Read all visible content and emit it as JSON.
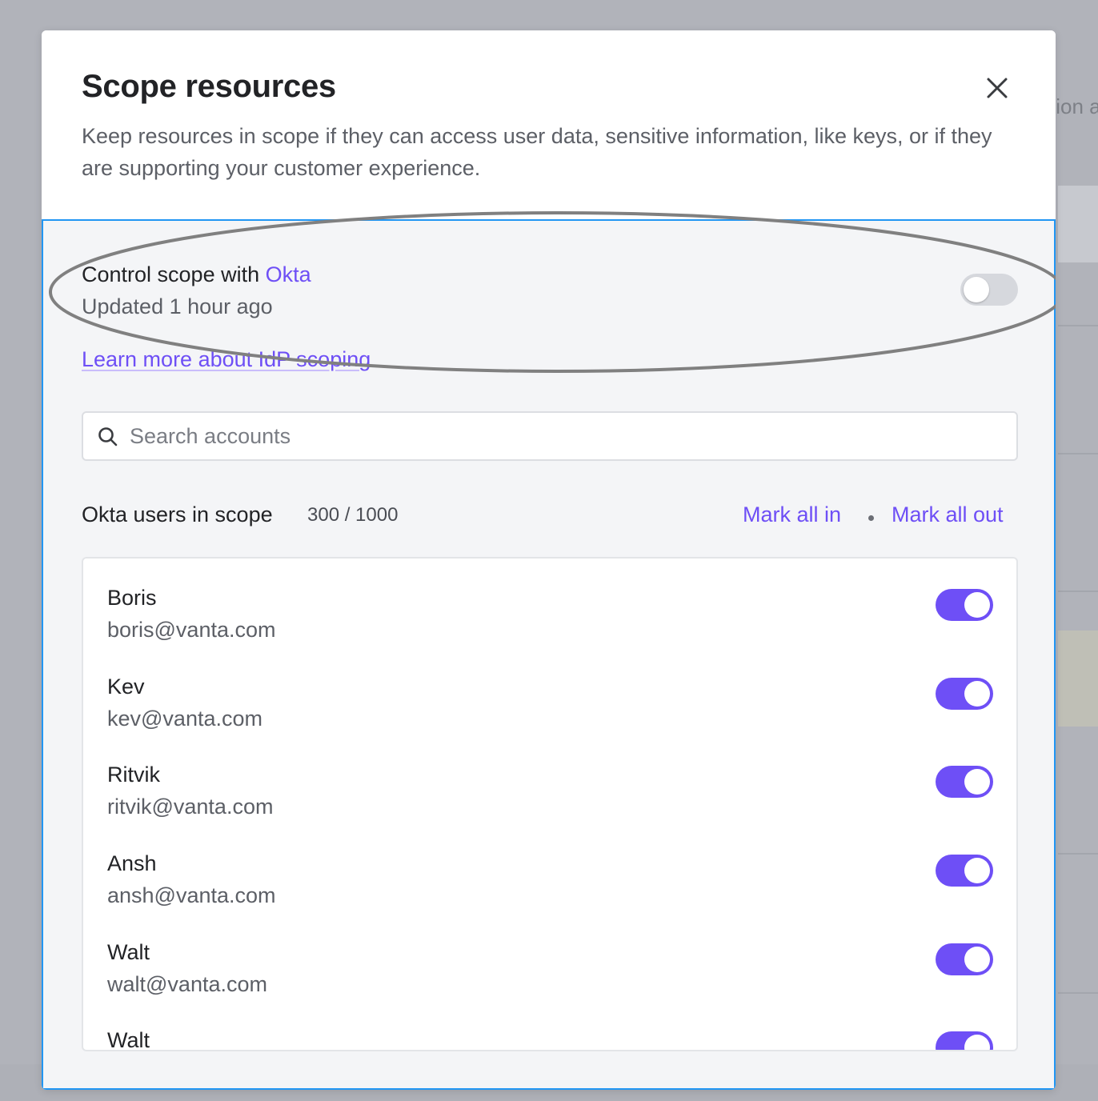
{
  "background": {
    "partial_text": "tion a"
  },
  "modal": {
    "title": "Scope resources",
    "close_icon": "close-icon",
    "subtitle": "Keep resources in scope if they can access user data, sensitive information, like keys, or if they are supporting your customer experience.",
    "idp": {
      "title_prefix": "Control scope with ",
      "provider": "Okta",
      "updated": "Updated 1 hour ago",
      "toggle_on": false,
      "learn_more": "Learn more about IdP scoping"
    },
    "search": {
      "placeholder": "Search accounts",
      "value": ""
    },
    "list": {
      "heading": "Okta users in scope",
      "count": "300 / 1000",
      "mark_all_in": "Mark all in",
      "mark_all_out": "Mark all out",
      "users": [
        {
          "name": "Boris",
          "email": "boris@vanta.com",
          "in_scope": true
        },
        {
          "name": "Kev",
          "email": "kev@vanta.com",
          "in_scope": true
        },
        {
          "name": "Ritvik",
          "email": "ritvik@vanta.com",
          "in_scope": true
        },
        {
          "name": "Ansh",
          "email": "ansh@vanta.com",
          "in_scope": true
        },
        {
          "name": "Walt",
          "email": "walt@vanta.com",
          "in_scope": true
        },
        {
          "name": "Walt",
          "email": "",
          "in_scope": true
        }
      ]
    }
  },
  "colors": {
    "accent": "#6e4ff6",
    "highlight_border": "#2196f3",
    "toggle_off": "#d6d8dd"
  }
}
